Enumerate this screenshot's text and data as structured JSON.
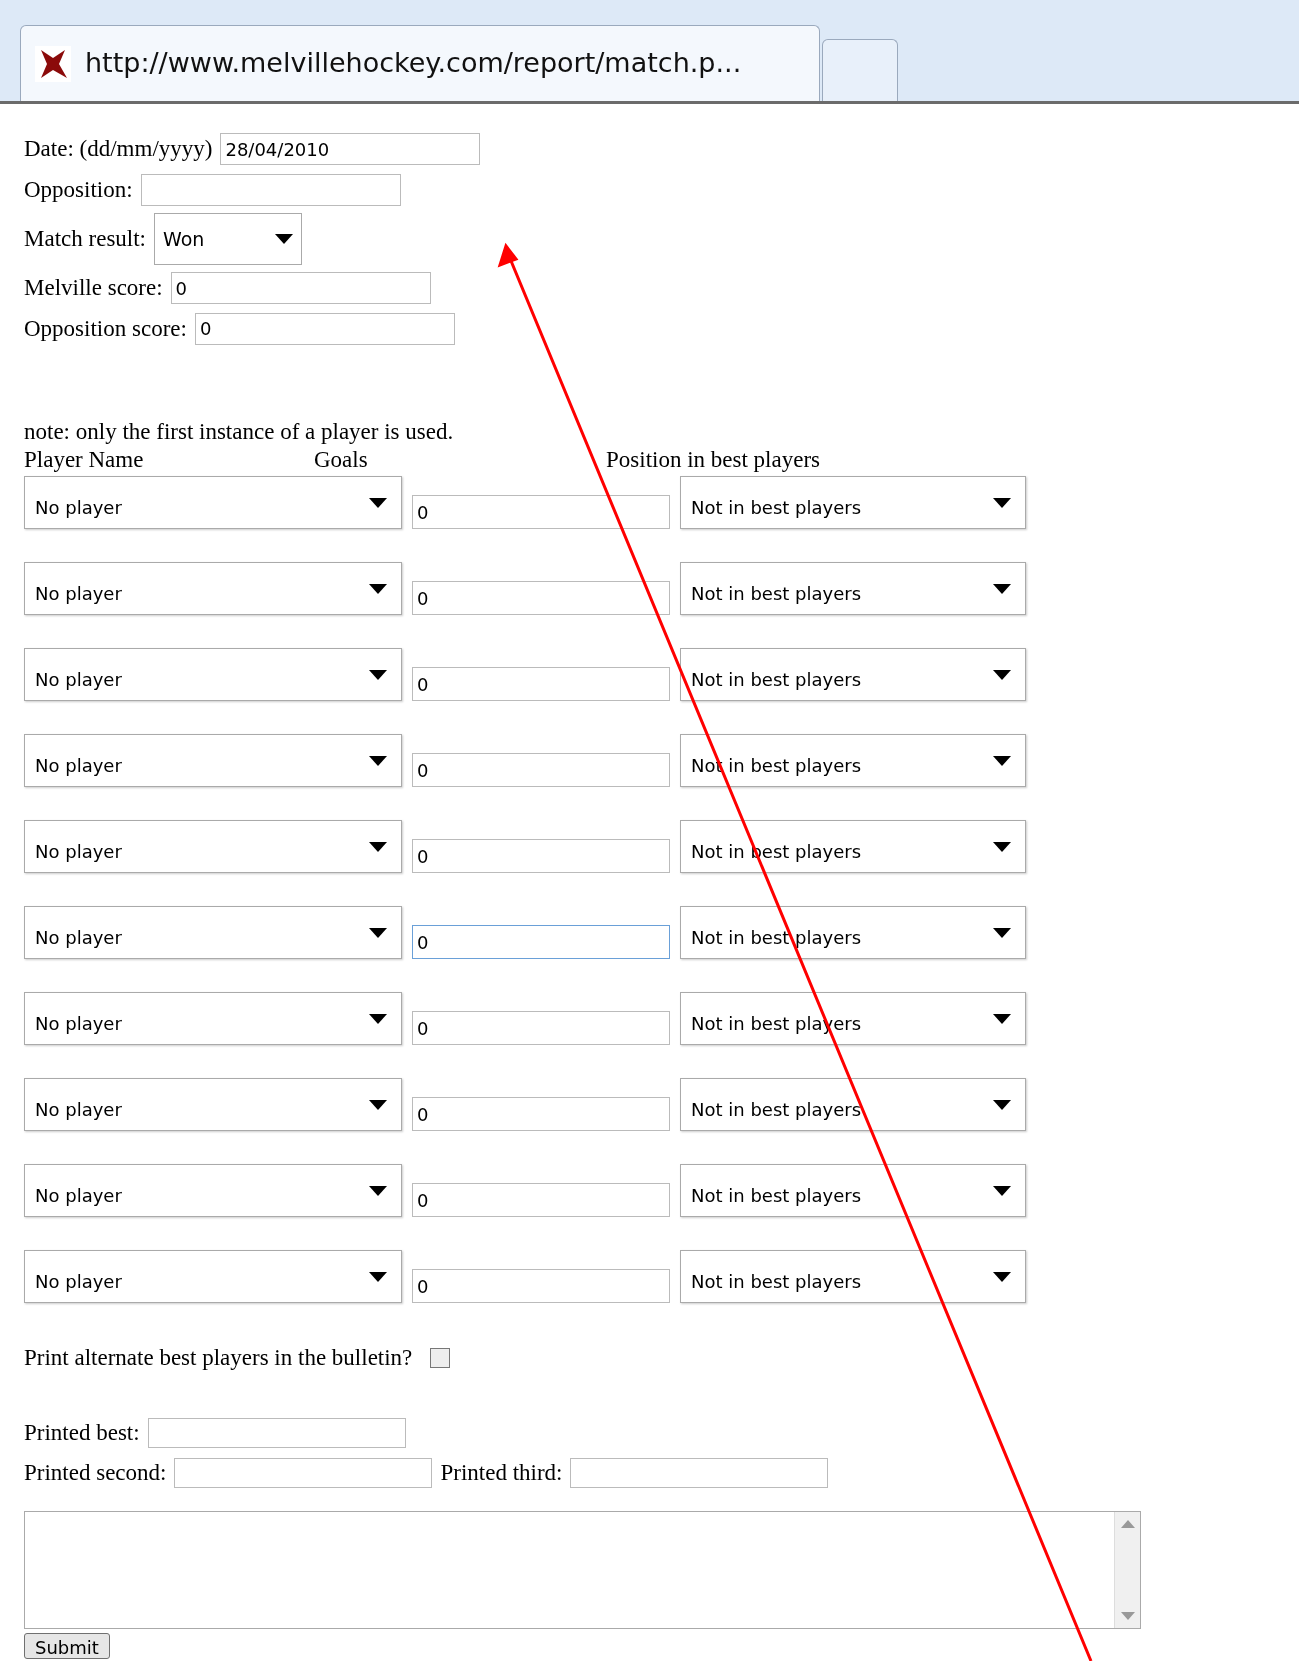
{
  "browser_tab": {
    "title": "http://www.melvillehockey.com/report/match.p...",
    "selected": true
  },
  "fields": [
    {
      "label": "Date: (dd/mm/yyyy)",
      "kind": "text",
      "value": "28/04/2010"
    },
    {
      "label": "Opposition:",
      "kind": "text"
    },
    {
      "label": "Match result:",
      "kind": "select",
      "value": "Won"
    },
    {
      "label": "Melville score:",
      "kind": "text",
      "value": "0"
    },
    {
      "label": "Opposition score:",
      "kind": "text",
      "value": "0"
    }
  ],
  "note": "note: only the first instance of a player is used.",
  "columns": [
    "Player Name",
    "Goals",
    "Position in best players"
  ],
  "players": [
    {
      "player": "No player",
      "goals": "0",
      "best": "Not in best players",
      "focused": false
    },
    {
      "player": "No player",
      "goals": "0",
      "best": "Not in best players",
      "focused": false
    },
    {
      "player": "No player",
      "goals": "0",
      "best": "Not in best players",
      "focused": false
    },
    {
      "player": "No player",
      "goals": "0",
      "best": "Not in best players",
      "focused": false
    },
    {
      "player": "No player",
      "goals": "0",
      "best": "Not in best players",
      "focused": false
    },
    {
      "player": "No player",
      "goals": "0",
      "best": "Not in best players",
      "focused": true
    },
    {
      "player": "No player",
      "goals": "0",
      "best": "Not in best players",
      "focused": false
    },
    {
      "player": "No player",
      "goals": "0",
      "best": "Not in best players",
      "focused": false
    },
    {
      "player": "No player",
      "goals": "0",
      "best": "Not in best players",
      "focused": false
    },
    {
      "player": "No player",
      "goals": "0",
      "best": "Not in best players",
      "focused": false
    }
  ],
  "alternate": {
    "label": "Print alternate best players in the bulletin?",
    "checked": false
  },
  "printed": [
    {
      "label": "Printed best:"
    },
    {
      "label": "Printed second:"
    },
    {
      "label": "Printed third:"
    }
  ],
  "submit": "Submit"
}
